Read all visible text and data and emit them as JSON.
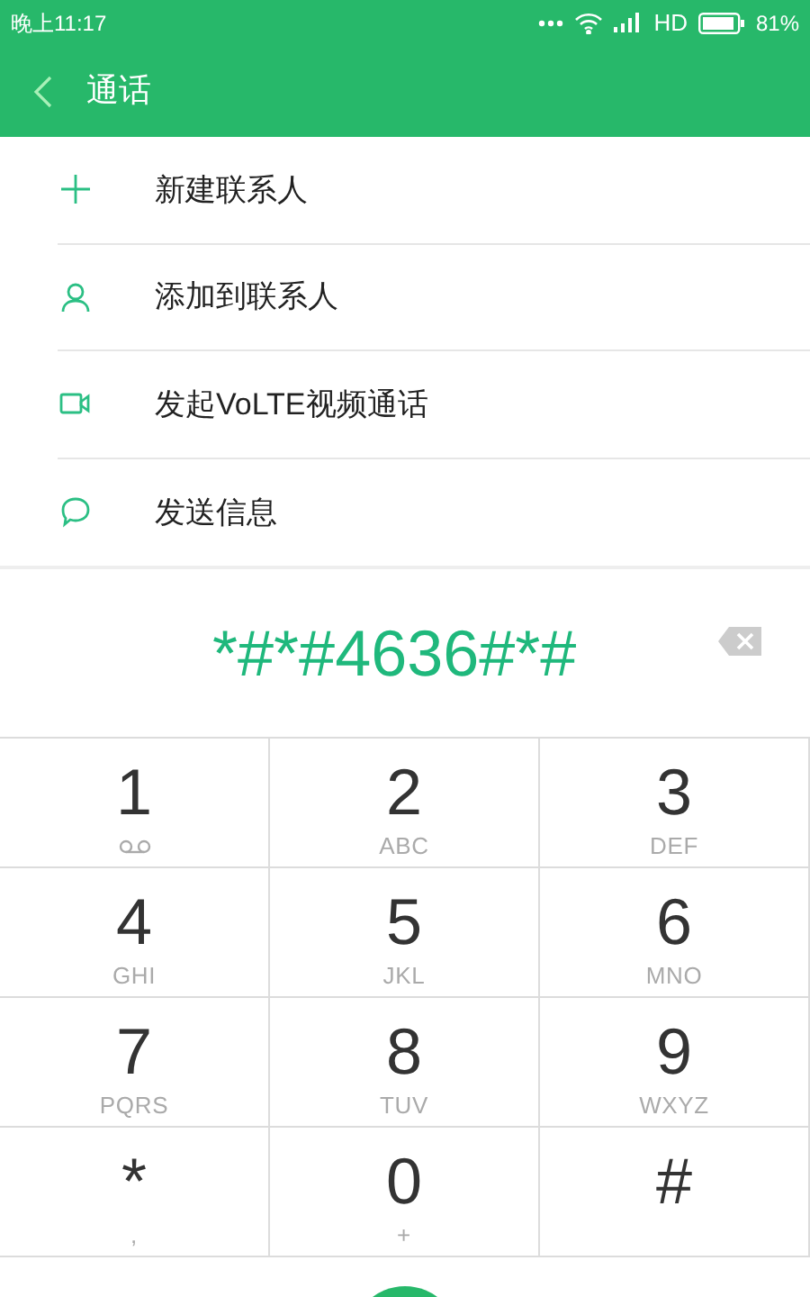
{
  "status_bar": {
    "time": "晚上11:17",
    "network": "HD",
    "battery": "81%"
  },
  "header": {
    "title": "通话"
  },
  "menu": [
    {
      "kind": "add",
      "label": "新建联系人"
    },
    {
      "kind": "person",
      "label": "添加到联系人"
    },
    {
      "kind": "video",
      "label": "发起VoLTE视频通话"
    },
    {
      "kind": "message",
      "label": "发送信息"
    }
  ],
  "dialed_number": "*#*#4636#*#",
  "keypad": [
    {
      "kind": "voicemail",
      "digit": "1"
    },
    {
      "kind": "letters",
      "digit": "2",
      "sub": "ABC"
    },
    {
      "kind": "letters",
      "digit": "3",
      "sub": "DEF"
    },
    {
      "kind": "letters",
      "digit": "4",
      "sub": "GHI"
    },
    {
      "kind": "letters",
      "digit": "5",
      "sub": "JKL"
    },
    {
      "kind": "letters",
      "digit": "6",
      "sub": "MNO"
    },
    {
      "kind": "letters",
      "digit": "7",
      "sub": "PQRS"
    },
    {
      "kind": "letters",
      "digit": "8",
      "sub": "TUV"
    },
    {
      "kind": "letters",
      "digit": "9",
      "sub": "WXYZ"
    },
    {
      "kind": "letters",
      "digit": "*",
      "sub": ","
    },
    {
      "kind": "letters",
      "digit": "0",
      "sub": "+"
    },
    {
      "kind": "plain",
      "digit": "#"
    }
  ]
}
